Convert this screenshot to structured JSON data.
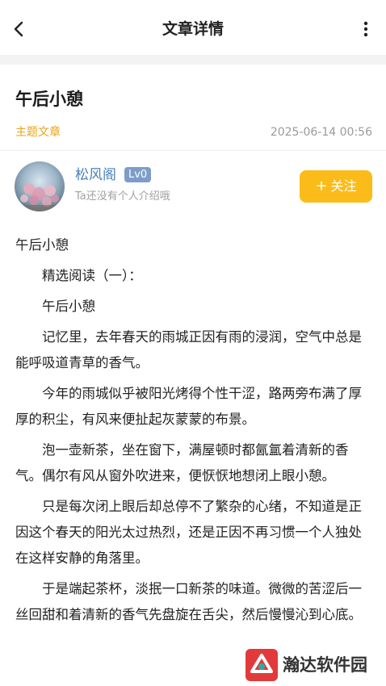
{
  "header": {
    "title": "文章详情",
    "back_icon": "chevron-left-icon",
    "more_icon": "more-vertical-icon"
  },
  "article": {
    "title": "午后小憩",
    "category": "主题文章",
    "timestamp": "2025-06-14 00:56"
  },
  "author": {
    "name": "松风阁",
    "level": "Lv0",
    "bio": "Ta还没有个人介绍哦",
    "follow_label": "关注",
    "follow_icon": "plus-icon"
  },
  "content": {
    "paragraphs": [
      "午后小憩",
      "精选阅读（一）：",
      "午后小憩",
      "记忆里，去年春天的雨城正因有雨的浸润，空气中总是能呼吸道青草的香气。",
      "今年的雨城似乎被阳光烤得个性干涩，路两旁布满了厚厚的积尘，有风来便扯起灰蒙蒙的布景。",
      "泡一壶新茶，坐在窗下，满屋顿时都氤氲着清新的香气。偶尔有风从窗外吹进来，便恹恹地想闭上眼小憩。",
      "只是每次闭上眼后却总停不了繁杂的心绪，不知道是正因这个春天的阳光太过热烈，还是正因不再习惯一个人独处在这样安静的角落里。",
      "于是端起茶杯，淡抿一口新茶的味道。微微的苦涩后一丝回甜和着清新的香气先盘旋在舌尖，然后慢慢沁到心底。"
    ]
  },
  "watermark": {
    "text": "瀚达软件园",
    "logo_icon": "watermark-logo-icon"
  },
  "colors": {
    "accent": "#fbbc1a",
    "category": "#e8a515",
    "author_name": "#4a7fb8",
    "badge": "#7d9dc9"
  }
}
